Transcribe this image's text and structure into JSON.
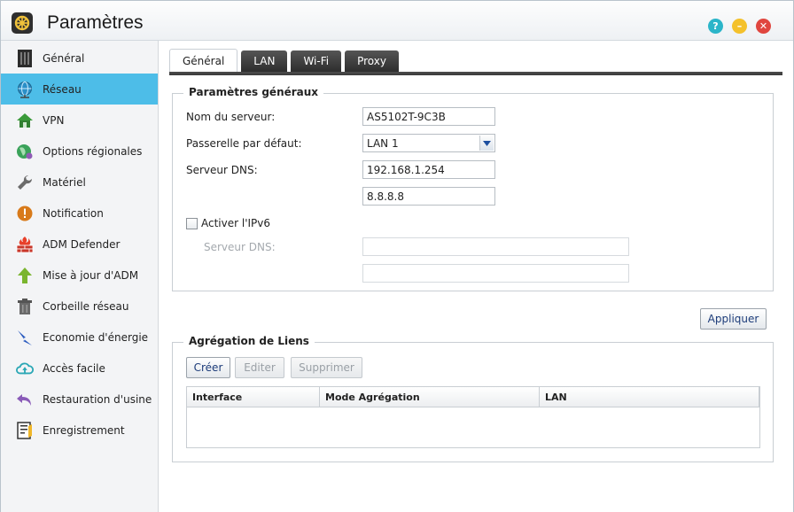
{
  "window": {
    "title": "Paramètres"
  },
  "sidebar": {
    "items": [
      {
        "label": "Général",
        "icon": "server-icon",
        "active": false
      },
      {
        "label": "Réseau",
        "icon": "globe-icon",
        "active": true
      },
      {
        "label": "VPN",
        "icon": "vpn-house-icon",
        "active": false
      },
      {
        "label": "Options régionales",
        "icon": "region-globe-icon",
        "active": false
      },
      {
        "label": "Matériel",
        "icon": "wrench-icon",
        "active": false
      },
      {
        "label": "Notification",
        "icon": "alert-icon",
        "active": false
      },
      {
        "label": "ADM Defender",
        "icon": "firewall-icon",
        "active": false
      },
      {
        "label": "Mise à jour d'ADM",
        "icon": "update-arrow-icon",
        "active": false
      },
      {
        "label": "Corbeille réseau",
        "icon": "trash-icon",
        "active": false
      },
      {
        "label": "Economie d'énergie",
        "icon": "energy-bolt-icon",
        "active": false
      },
      {
        "label": "Accès facile",
        "icon": "cloud-icon",
        "active": false
      },
      {
        "label": "Restauration d'usine",
        "icon": "restore-arrow-icon",
        "active": false
      },
      {
        "label": "Enregistrement",
        "icon": "registration-icon",
        "active": false
      }
    ]
  },
  "tabs": [
    {
      "label": "Général",
      "active": true
    },
    {
      "label": "LAN",
      "active": false
    },
    {
      "label": "Wi-Fi",
      "active": false
    },
    {
      "label": "Proxy",
      "active": false
    }
  ],
  "general": {
    "legend": "Paramètres généraux",
    "server_name_label": "Nom du serveur:",
    "server_name_value": "AS5102T-9C3B",
    "gateway_label": "Passerelle par défaut:",
    "gateway_value": "LAN 1",
    "dns_label": "Serveur DNS:",
    "dns_primary": "192.168.1.254",
    "dns_secondary": "8.8.8.8",
    "ipv6_label": "Activer l'IPv6",
    "ipv6_checked": false,
    "ipv6_dns_label": "Serveur DNS:",
    "ipv6_dns_primary": "",
    "ipv6_dns_secondary": ""
  },
  "apply_label": "Appliquer",
  "aggregation": {
    "legend": "Agrégation de Liens",
    "create_label": "Créer",
    "edit_label": "Editer",
    "delete_label": "Supprimer",
    "columns": [
      "Interface",
      "Mode Agrégation",
      "LAN"
    ],
    "rows": []
  },
  "colors": {
    "active_sidebar": "#4dbde8",
    "tab_dark": "#3a3a3a"
  }
}
